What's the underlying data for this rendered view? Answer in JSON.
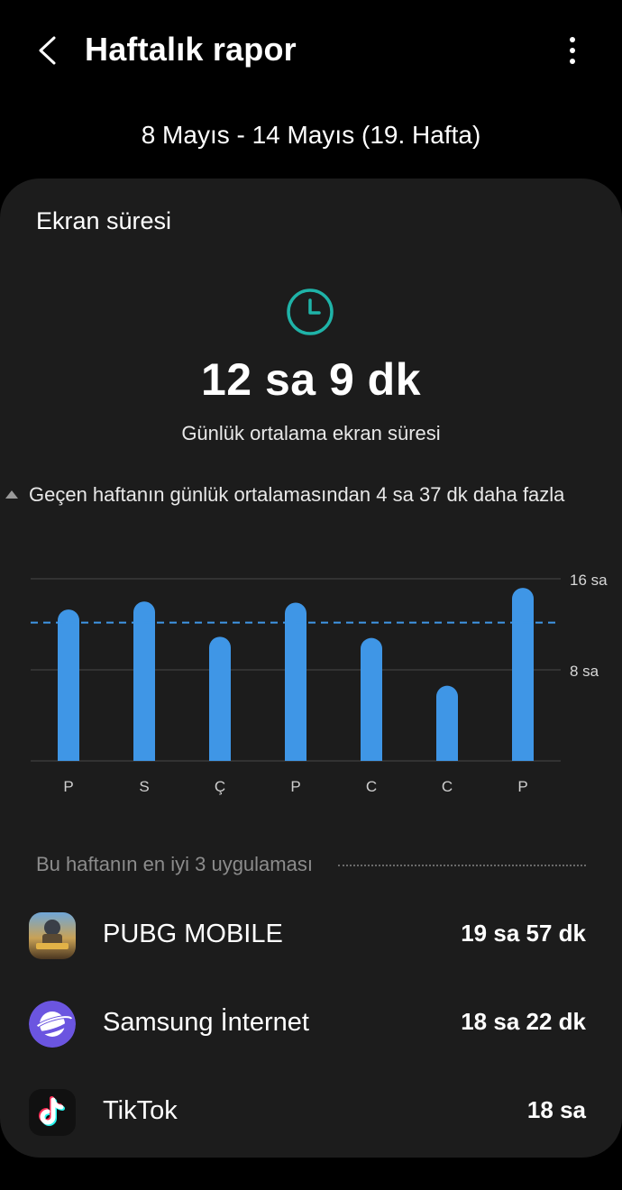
{
  "header": {
    "title": "Haftalık rapor"
  },
  "week_range": "8 Mayıs - 14 Mayıs (19. Hafta)",
  "screen_time": {
    "section_title": "Ekran süresi",
    "daily_average": "12 sa 9 dk",
    "daily_average_caption": "Günlük ortalama ekran süresi",
    "comparison": "Geçen haftanın günlük ortalamasından 4 sa 37 dk daha fazla"
  },
  "chart_data": {
    "type": "bar",
    "categories": [
      "P",
      "S",
      "Ç",
      "P",
      "C",
      "C",
      "P"
    ],
    "values": [
      13.3,
      14.0,
      10.9,
      13.9,
      10.8,
      6.6,
      15.2
    ],
    "ylim": [
      0,
      16
    ],
    "y_tick_labels": [
      "16 sa",
      "8 sa"
    ],
    "y_tick_values": [
      16,
      8
    ],
    "average_line": 12.15,
    "grid": true,
    "colors": {
      "bar": "#3f96e6",
      "average_line": "#3f96e6",
      "grid": "#3a3a3a"
    }
  },
  "top_apps": {
    "title": "Bu haftanın en iyi 3 uygulaması",
    "items": [
      {
        "name": "PUBG MOBILE",
        "time": "19 sa 57 dk",
        "icon": "pubg-mobile-icon"
      },
      {
        "name": "Samsung İnternet",
        "time": "18 sa 22 dk",
        "icon": "samsung-internet-icon"
      },
      {
        "name": "TikTok",
        "time": "18 sa",
        "icon": "tiktok-icon"
      }
    ]
  },
  "colors": {
    "accent": "#1fb3a8",
    "card_bg": "#1c1c1c",
    "background": "#000000"
  }
}
